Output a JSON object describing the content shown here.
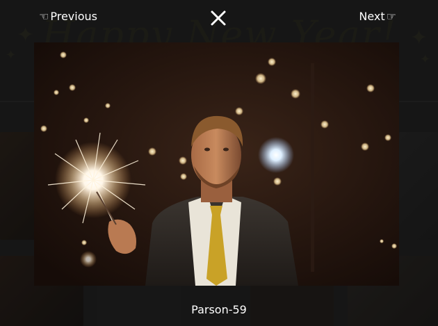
{
  "lightbox": {
    "previous_label": "Previous",
    "next_label": "Next",
    "caption": "Parson-59",
    "prev_icon": "pointing-hand-left-icon",
    "next_icon": "pointing-hand-right-icon",
    "close_icon": "close-icon"
  },
  "background": {
    "banner_text": "Happy New Year!"
  },
  "colors": {
    "overlay": "#1c1c1c",
    "text": "#ffffff",
    "photo_dark": "#23150f",
    "tie": "#c9a227"
  }
}
